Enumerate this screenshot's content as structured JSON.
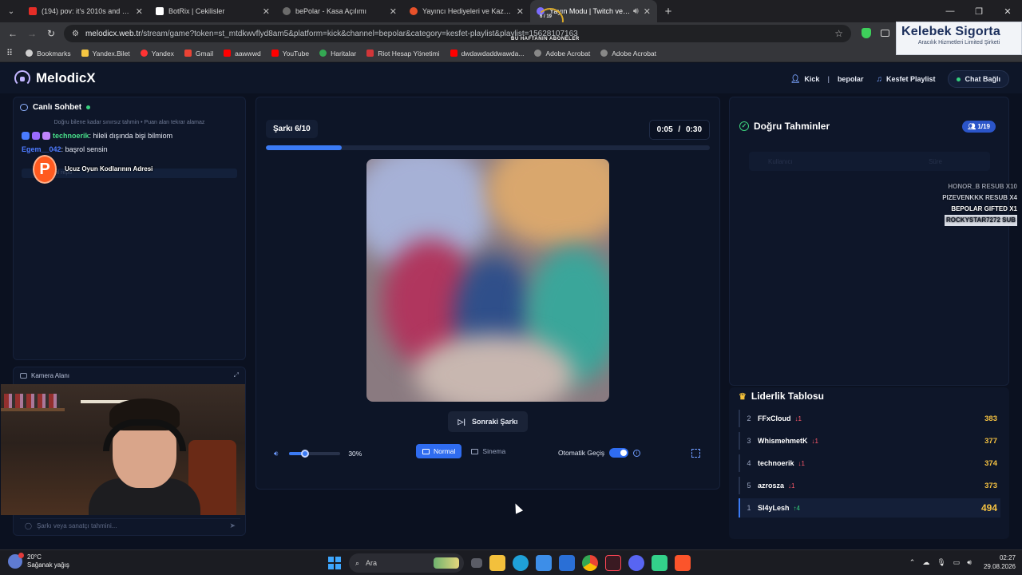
{
  "browser": {
    "tabs": [
      {
        "title": "(194) pov: it's 2010s and you are",
        "color": "#e52d27",
        "active": false
      },
      {
        "title": "BotRix | Cekilisler",
        "color": "#ffffff",
        "active": false
      },
      {
        "title": "bePolar - Kasa Açılımı",
        "color": "#5a5a5a",
        "active": false
      },
      {
        "title": "Yayıncı Hediyeleri ve Kazananlar",
        "color": "#e8512a",
        "active": false
      },
      {
        "title": "Yayın Modu | Twitch ve Kick",
        "color": "#7b6cff",
        "active": true
      }
    ],
    "url_host": "melodicx.web.tr",
    "url_path": "/stream/game?token=st_mtdkwvflyd8am5&platform=kick&channel=bepolar&category=kesfet-playlist&playlist=15628107163",
    "bookmarks": [
      {
        "label": "Bookmarks",
        "color": "#cfcfcf"
      },
      {
        "label": "Yandex.Bilet",
        "color": "#f4c542"
      },
      {
        "label": "Yandex",
        "color": "#ff3333"
      },
      {
        "label": "Gmail",
        "color": "#ea4335"
      },
      {
        "label": "aawwwd",
        "color": "#ff0000"
      },
      {
        "label": "YouTube",
        "color": "#ff0000"
      },
      {
        "label": "Haritalar",
        "color": "#34a853"
      },
      {
        "label": "Riot Hesap Yönetimi",
        "color": "#d13639"
      },
      {
        "label": "dwdawdaddwawda...",
        "color": "#ff0000"
      },
      {
        "label": "Adobe Acrobat",
        "color": "#888888"
      },
      {
        "label": "Adobe Acrobat",
        "color": "#888888"
      }
    ]
  },
  "overlay": {
    "sponsor_name": "Kelebek Sigorta",
    "sponsor_sub": "Aracılık Hizmetleri Limited Şirketi",
    "hud_label": "BU HAFTANIN ABONELER",
    "hud_counter": "6 / 19",
    "promo_letter": "P",
    "promo_text": "Ucuz Oyun Kodlarının Adresi",
    "subs": [
      "HONOR_B RESUB X10",
      "PIZEVENKKK RESUB X4",
      "BEPOLAR GIFTED X1",
      "ROCKYSTAR7272 SUB"
    ]
  },
  "app": {
    "name": "MelodicX",
    "platform": "Kick",
    "channel": "bepolar",
    "playlist_label": "Kesfet Playlist",
    "chat_status": "Chat Bağlı"
  },
  "chat": {
    "title": "Canlı Sohbet",
    "hint": "Doğru bilene kadar sınırsız tahmin • Puan alan tekrar alamaz",
    "messages": [
      {
        "user": "technoerik",
        "text": "hileli dışında bişi bilmiom"
      },
      {
        "user": "Egem__042",
        "text": "başrol sensin"
      }
    ],
    "faded_line": "Mer ribal repo",
    "input_placeholder": "Şarkı veya sanatçı tahmini..."
  },
  "camera": {
    "title": "Kamera Alanı"
  },
  "player": {
    "song_counter": "Şarkı 6/10",
    "time_current": "0:05",
    "time_sep": "/",
    "time_total": "0:30",
    "progress": 0.17,
    "next_label": "Sonraki Şarkı",
    "volume": 0.3,
    "volume_label": "30%",
    "mode_normal": "Normal",
    "mode_cinema": "Sinema",
    "auto_label": "Otomatik Geçiş"
  },
  "guesses": {
    "title": "Doğru Tahminler",
    "badge": "1/19",
    "ghost_left": "Kullanıcı",
    "ghost_right": "Süre"
  },
  "leaderboard": {
    "title": "Liderlik Tablosu",
    "rows": [
      {
        "rank": "2",
        "name": "FFxCloud",
        "change": "↓1",
        "dir": "down",
        "points": "383"
      },
      {
        "rank": "3",
        "name": "WhismehmetK",
        "change": "↓1",
        "dir": "down",
        "points": "377"
      },
      {
        "rank": "4",
        "name": "technoerik",
        "change": "↓1",
        "dir": "down",
        "points": "374"
      },
      {
        "rank": "5",
        "name": "azrosza",
        "change": "↓1",
        "dir": "down",
        "points": "373"
      },
      {
        "rank": "1",
        "name": "Sl4yLesh",
        "change": "↑4",
        "dir": "up",
        "points": "494"
      }
    ]
  },
  "taskbar": {
    "temp": "20°C",
    "weather": "Sağanak yağış",
    "search": "Ara",
    "time": "02:27",
    "date": "29.08.2026"
  }
}
